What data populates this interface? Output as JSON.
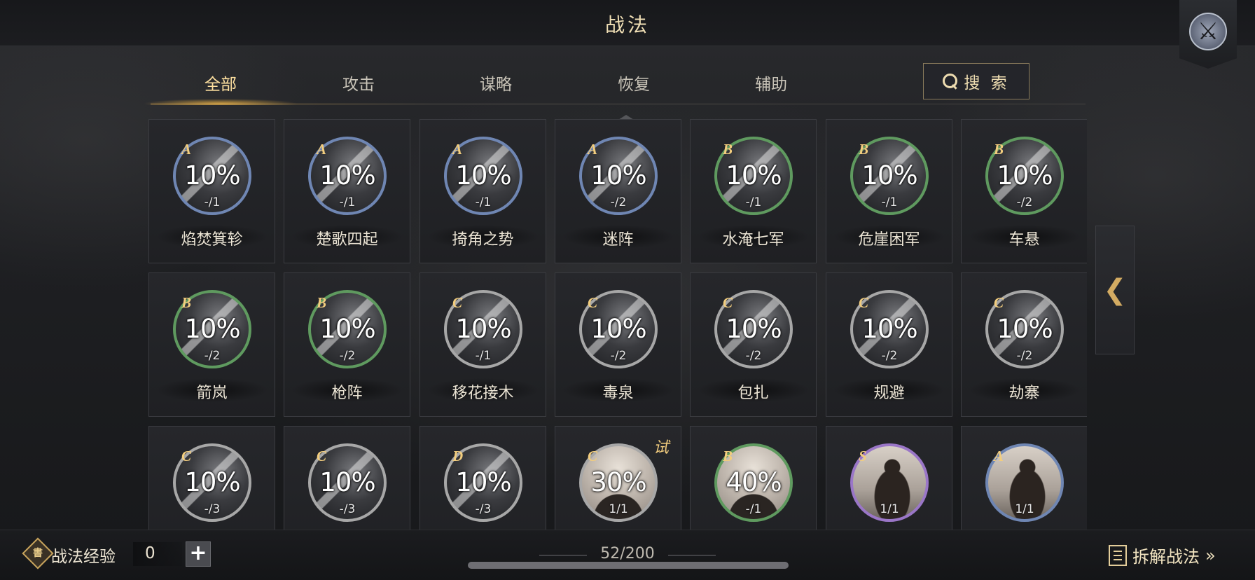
{
  "title": "战法",
  "tabs": [
    {
      "label": "全部",
      "active": true
    },
    {
      "label": "攻击",
      "active": false
    },
    {
      "label": "谋略",
      "active": false
    },
    {
      "label": "恢复",
      "active": false
    },
    {
      "label": "辅助",
      "active": false
    }
  ],
  "search_label": "搜 索",
  "cards": [
    {
      "grade": "A",
      "pct": "10%",
      "count": "-/1",
      "name": "焰焚箕轸",
      "style": "dark"
    },
    {
      "grade": "A",
      "pct": "10%",
      "count": "-/1",
      "name": "楚歌四起",
      "style": "dark"
    },
    {
      "grade": "A",
      "pct": "10%",
      "count": "-/1",
      "name": "掎角之势",
      "style": "dark"
    },
    {
      "grade": "A",
      "pct": "10%",
      "count": "-/2",
      "name": "迷阵",
      "style": "dark"
    },
    {
      "grade": "B",
      "pct": "10%",
      "count": "-/1",
      "name": "水淹七军",
      "style": "dark"
    },
    {
      "grade": "B",
      "pct": "10%",
      "count": "-/1",
      "name": "危崖困军",
      "style": "dark"
    },
    {
      "grade": "B",
      "pct": "10%",
      "count": "-/2",
      "name": "车悬",
      "style": "dark"
    },
    {
      "grade": "B",
      "pct": "10%",
      "count": "-/2",
      "name": "箭岚",
      "style": "dark"
    },
    {
      "grade": "B",
      "pct": "10%",
      "count": "-/2",
      "name": "枪阵",
      "style": "dark"
    },
    {
      "grade": "C",
      "pct": "10%",
      "count": "-/1",
      "name": "移花接木",
      "style": "dark"
    },
    {
      "grade": "C",
      "pct": "10%",
      "count": "-/2",
      "name": "毒泉",
      "style": "dark"
    },
    {
      "grade": "C",
      "pct": "10%",
      "count": "-/2",
      "name": "包扎",
      "style": "dark"
    },
    {
      "grade": "C",
      "pct": "10%",
      "count": "-/2",
      "name": "规避",
      "style": "dark"
    },
    {
      "grade": "C",
      "pct": "10%",
      "count": "-/2",
      "name": "劫寨",
      "style": "dark"
    },
    {
      "grade": "C",
      "pct": "10%",
      "count": "-/3",
      "name": "",
      "style": "dark"
    },
    {
      "grade": "C",
      "pct": "10%",
      "count": "-/3",
      "name": "",
      "style": "dark"
    },
    {
      "grade": "D",
      "pct": "10%",
      "count": "-/3",
      "name": "",
      "style": "dark"
    },
    {
      "grade": "C",
      "pct": "30%",
      "count": "1/1",
      "name": "",
      "style": "light",
      "trial": "试"
    },
    {
      "grade": "B",
      "pct": "40%",
      "count": "-/1",
      "name": "",
      "style": "light"
    },
    {
      "grade": "S",
      "pct": "",
      "count": "1/1",
      "name": "",
      "style": "light"
    },
    {
      "grade": "A",
      "pct": "",
      "count": "1/1",
      "name": "",
      "style": "light"
    }
  ],
  "side_tab_icon": "chevron-left-icon",
  "footer": {
    "exp_label": "战法经验",
    "exp_value": "0",
    "add_label": "+",
    "count": "52/200",
    "dismantle_label": "拆解战法",
    "dismantle_arrow": "»"
  },
  "colors": {
    "accent_gold": "#f2cd7e",
    "grade_A": "#6f86b3",
    "grade_B": "#5f9a5f",
    "grade_C": "#a7a7a7",
    "grade_S": "#9a76c7"
  }
}
